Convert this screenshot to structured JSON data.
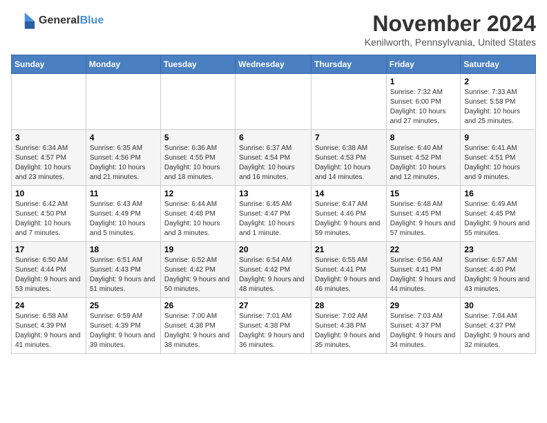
{
  "header": {
    "logo_general": "General",
    "logo_blue": "Blue",
    "title": "November 2024",
    "location": "Kenilworth, Pennsylvania, United States"
  },
  "days_of_week": [
    "Sunday",
    "Monday",
    "Tuesday",
    "Wednesday",
    "Thursday",
    "Friday",
    "Saturday"
  ],
  "weeks": [
    [
      {
        "day": "",
        "info": ""
      },
      {
        "day": "",
        "info": ""
      },
      {
        "day": "",
        "info": ""
      },
      {
        "day": "",
        "info": ""
      },
      {
        "day": "",
        "info": ""
      },
      {
        "day": "1",
        "info": "Sunrise: 7:32 AM\nSunset: 6:00 PM\nDaylight: 10 hours and 27 minutes."
      },
      {
        "day": "2",
        "info": "Sunrise: 7:33 AM\nSunset: 5:58 PM\nDaylight: 10 hours and 25 minutes."
      }
    ],
    [
      {
        "day": "3",
        "info": "Sunrise: 6:34 AM\nSunset: 4:57 PM\nDaylight: 10 hours and 23 minutes."
      },
      {
        "day": "4",
        "info": "Sunrise: 6:35 AM\nSunset: 4:56 PM\nDaylight: 10 hours and 21 minutes."
      },
      {
        "day": "5",
        "info": "Sunrise: 6:36 AM\nSunset: 4:55 PM\nDaylight: 10 hours and 18 minutes."
      },
      {
        "day": "6",
        "info": "Sunrise: 6:37 AM\nSunset: 4:54 PM\nDaylight: 10 hours and 16 minutes."
      },
      {
        "day": "7",
        "info": "Sunrise: 6:38 AM\nSunset: 4:53 PM\nDaylight: 10 hours and 14 minutes."
      },
      {
        "day": "8",
        "info": "Sunrise: 6:40 AM\nSunset: 4:52 PM\nDaylight: 10 hours and 12 minutes."
      },
      {
        "day": "9",
        "info": "Sunrise: 6:41 AM\nSunset: 4:51 PM\nDaylight: 10 hours and 9 minutes."
      }
    ],
    [
      {
        "day": "10",
        "info": "Sunrise: 6:42 AM\nSunset: 4:50 PM\nDaylight: 10 hours and 7 minutes."
      },
      {
        "day": "11",
        "info": "Sunrise: 6:43 AM\nSunset: 4:49 PM\nDaylight: 10 hours and 5 minutes."
      },
      {
        "day": "12",
        "info": "Sunrise: 6:44 AM\nSunset: 4:48 PM\nDaylight: 10 hours and 3 minutes."
      },
      {
        "day": "13",
        "info": "Sunrise: 6:45 AM\nSunset: 4:47 PM\nDaylight: 10 hours and 1 minute."
      },
      {
        "day": "14",
        "info": "Sunrise: 6:47 AM\nSunset: 4:46 PM\nDaylight: 9 hours and 59 minutes."
      },
      {
        "day": "15",
        "info": "Sunrise: 6:48 AM\nSunset: 4:45 PM\nDaylight: 9 hours and 57 minutes."
      },
      {
        "day": "16",
        "info": "Sunrise: 6:49 AM\nSunset: 4:45 PM\nDaylight: 9 hours and 55 minutes."
      }
    ],
    [
      {
        "day": "17",
        "info": "Sunrise: 6:50 AM\nSunset: 4:44 PM\nDaylight: 9 hours and 53 minutes."
      },
      {
        "day": "18",
        "info": "Sunrise: 6:51 AM\nSunset: 4:43 PM\nDaylight: 9 hours and 51 minutes."
      },
      {
        "day": "19",
        "info": "Sunrise: 6:52 AM\nSunset: 4:42 PM\nDaylight: 9 hours and 50 minutes."
      },
      {
        "day": "20",
        "info": "Sunrise: 6:54 AM\nSunset: 4:42 PM\nDaylight: 9 hours and 48 minutes."
      },
      {
        "day": "21",
        "info": "Sunrise: 6:55 AM\nSunset: 4:41 PM\nDaylight: 9 hours and 46 minutes."
      },
      {
        "day": "22",
        "info": "Sunrise: 6:56 AM\nSunset: 4:41 PM\nDaylight: 9 hours and 44 minutes."
      },
      {
        "day": "23",
        "info": "Sunrise: 6:57 AM\nSunset: 4:40 PM\nDaylight: 9 hours and 43 minutes."
      }
    ],
    [
      {
        "day": "24",
        "info": "Sunrise: 6:58 AM\nSunset: 4:39 PM\nDaylight: 9 hours and 41 minutes."
      },
      {
        "day": "25",
        "info": "Sunrise: 6:59 AM\nSunset: 4:39 PM\nDaylight: 9 hours and 39 minutes."
      },
      {
        "day": "26",
        "info": "Sunrise: 7:00 AM\nSunset: 4:38 PM\nDaylight: 9 hours and 38 minutes."
      },
      {
        "day": "27",
        "info": "Sunrise: 7:01 AM\nSunset: 4:38 PM\nDaylight: 9 hours and 36 minutes."
      },
      {
        "day": "28",
        "info": "Sunrise: 7:02 AM\nSunset: 4:38 PM\nDaylight: 9 hours and 35 minutes."
      },
      {
        "day": "29",
        "info": "Sunrise: 7:03 AM\nSunset: 4:37 PM\nDaylight: 9 hours and 34 minutes."
      },
      {
        "day": "30",
        "info": "Sunrise: 7:04 AM\nSunset: 4:37 PM\nDaylight: 9 hours and 32 minutes."
      }
    ]
  ]
}
